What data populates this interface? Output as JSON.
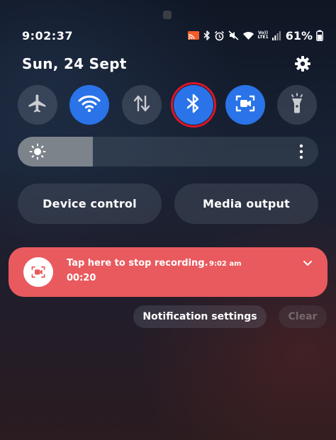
{
  "status_bar": {
    "time": "9:02:37",
    "network_label_top": "Vo))",
    "network_label_bottom": "LTE1",
    "battery": "61%",
    "icons": [
      "cast-icon",
      "bluetooth-icon",
      "alarm-icon",
      "mute-icon",
      "wifi-icon",
      "network-label",
      "signal-icon",
      "battery-icon"
    ]
  },
  "header": {
    "date": "Sun, 24 Sept",
    "settings_icon": "gear-icon"
  },
  "quick_tiles": [
    {
      "name": "airplane-mode",
      "icon": "airplane-icon",
      "state": "off"
    },
    {
      "name": "wifi",
      "icon": "wifi-icon",
      "state": "on"
    },
    {
      "name": "mobile-data",
      "icon": "data-arrows-icon",
      "state": "off"
    },
    {
      "name": "bluetooth",
      "icon": "bluetooth-icon",
      "state": "on",
      "highlighted": true
    },
    {
      "name": "screen-recorder",
      "icon": "screen-record-icon",
      "state": "on"
    },
    {
      "name": "flashlight",
      "icon": "flashlight-icon",
      "state": "off"
    }
  ],
  "brightness": {
    "level": 0.25,
    "icon": "sun-icon",
    "more_icon": "more-vertical-icon"
  },
  "buttons": {
    "device_control": "Device control",
    "media_output": "Media output"
  },
  "notification": {
    "title": "Tap here to stop recording.",
    "time": "9:02 am",
    "timer": "00:20",
    "icon": "screen-record-icon",
    "expand_icon": "chevron-down-icon"
  },
  "footer": {
    "notification_settings": "Notification settings",
    "clear": "Clear"
  },
  "colors": {
    "accent_blue": "#2a73e8",
    "notification_red": "#e95a5e",
    "highlight_ring": "#e0142a"
  }
}
